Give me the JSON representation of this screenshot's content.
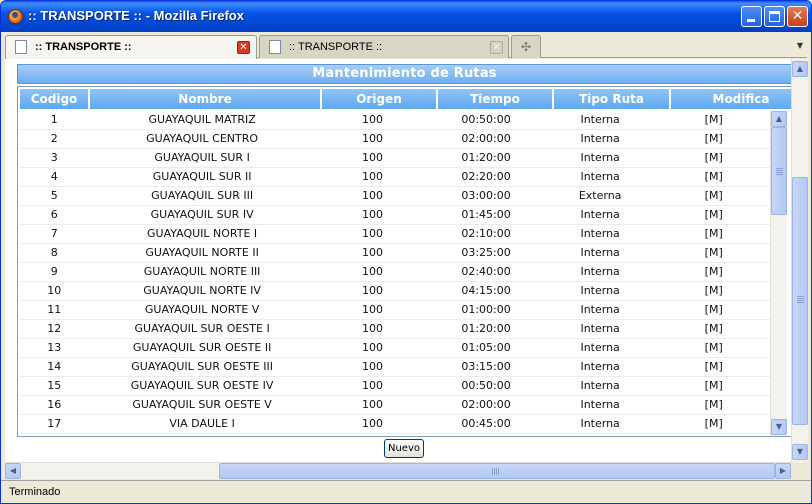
{
  "window": {
    "title": ":: TRANSPORTE :: - Mozilla Firefox"
  },
  "tabs": [
    {
      "label": ":: TRANSPORTE ::",
      "active": true
    },
    {
      "label": ":: TRANSPORTE ::",
      "active": false
    }
  ],
  "panel": {
    "title": "Mantenimiento de Rutas"
  },
  "table": {
    "columns": [
      "Codigo",
      "Nombre",
      "Origen",
      "Tiempo",
      "Tipo Ruta",
      "Modifica"
    ],
    "rows": [
      [
        "1",
        "GUAYAQUIL MATRIZ",
        "100",
        "00:50:00",
        "Interna",
        "[M]"
      ],
      [
        "2",
        "GUAYAQUIL CENTRO",
        "100",
        "02:00:00",
        "Interna",
        "[M]"
      ],
      [
        "3",
        "GUAYAQUIL SUR I",
        "100",
        "01:20:00",
        "Interna",
        "[M]"
      ],
      [
        "4",
        "GUAYAQUIL SUR II",
        "100",
        "02:20:00",
        "Interna",
        "[M]"
      ],
      [
        "5",
        "GUAYAQUIL SUR III",
        "100",
        "03:00:00",
        "Externa",
        "[M]"
      ],
      [
        "6",
        "GUAYAQUIL SUR IV",
        "100",
        "01:45:00",
        "Interna",
        "[M]"
      ],
      [
        "7",
        "GUAYAQUIL NORTE I",
        "100",
        "02:10:00",
        "Interna",
        "[M]"
      ],
      [
        "8",
        "GUAYAQUIL NORTE II",
        "100",
        "03:25:00",
        "Interna",
        "[M]"
      ],
      [
        "9",
        "GUAYAQUIL NORTE III",
        "100",
        "02:40:00",
        "Interna",
        "[M]"
      ],
      [
        "10",
        "GUAYAQUIL NORTE IV",
        "100",
        "04:15:00",
        "Interna",
        "[M]"
      ],
      [
        "11",
        "GUAYAQUIL NORTE V",
        "100",
        "01:00:00",
        "Interna",
        "[M]"
      ],
      [
        "12",
        "GUAYAQUIL SUR OESTE I",
        "100",
        "01:20:00",
        "Interna",
        "[M]"
      ],
      [
        "13",
        "GUAYAQUIL SUR OESTE II",
        "100",
        "01:05:00",
        "Interna",
        "[M]"
      ],
      [
        "14",
        "GUAYAQUIL SUR OESTE III",
        "100",
        "03:15:00",
        "Interna",
        "[M]"
      ],
      [
        "15",
        "GUAYAQUIL SUR OESTE IV",
        "100",
        "00:50:00",
        "Interna",
        "[M]"
      ],
      [
        "16",
        "GUAYAQUIL SUR OESTE V",
        "100",
        "02:00:00",
        "Interna",
        "[M]"
      ],
      [
        "17",
        "VIA DAULE I",
        "100",
        "00:45:00",
        "Interna",
        "[M]"
      ]
    ]
  },
  "buttons": {
    "nuevo": "Nuevo"
  },
  "statusbar": {
    "text": "Terminado"
  },
  "colors": {
    "titlebar": "#0552e6",
    "header_blue": "#6faef0",
    "close_red": "#d93b2b"
  }
}
